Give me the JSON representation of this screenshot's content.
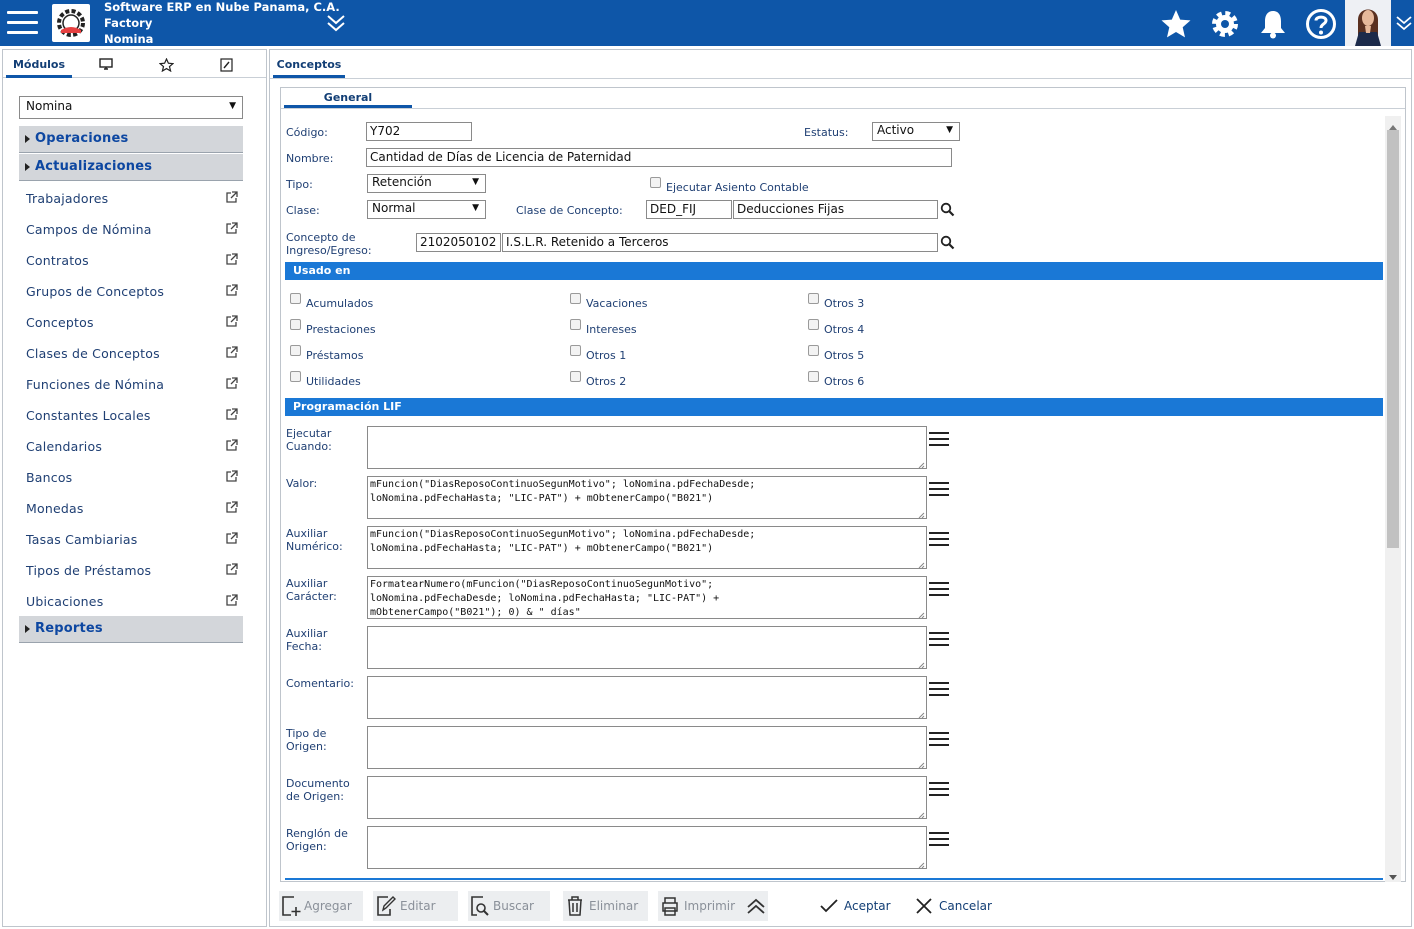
{
  "header": {
    "company_line1": "Software ERP en Nube Panama, C.A.",
    "company_line2": "Factory",
    "company_line3": "Nomina",
    "icons": [
      "menu-icon",
      "logo-icon",
      "chevron-double-down-icon",
      "star-icon",
      "gear-icon",
      "bell-icon",
      "help-icon",
      "avatar",
      "chevron-down-icon"
    ]
  },
  "sidebar": {
    "tabs": [
      {
        "label": "Módulos",
        "active": true
      },
      {
        "icon": "monitor-icon"
      },
      {
        "icon": "star-icon"
      },
      {
        "icon": "edit-icon"
      }
    ],
    "module_select": "Nomina",
    "sections": {
      "operaciones": "Operaciones",
      "actualizaciones": "Actualizaciones",
      "reportes": "Reportes"
    },
    "items": [
      "Trabajadores",
      "Campos de Nómina",
      "Contratos",
      "Grupos de Conceptos",
      "Conceptos",
      "Clases de Conceptos",
      "Funciones de Nómina",
      "Constantes Locales",
      "Calendarios",
      "Bancos",
      "Monedas",
      "Tasas Cambiarias",
      "Tipos de Préstamos",
      "Ubicaciones"
    ]
  },
  "main": {
    "tab": "Conceptos",
    "subtab": "General",
    "form": {
      "codigo_label": "Código:",
      "codigo": "Y702",
      "estatus_label": "Estatus:",
      "estatus": "Activo",
      "nombre_label": "Nombre:",
      "nombre": "Cantidad de Días de Licencia de Paternidad",
      "tipo_label": "Tipo:",
      "tipo": "Retención",
      "asiento_label": "Ejecutar Asiento Contable",
      "clase_label": "Clase:",
      "clase": "Normal",
      "clase_concepto_label": "Clase de Concepto:",
      "clase_concepto_code": "DED_FIJ",
      "clase_concepto_name": "Deducciones Fijas",
      "ingreso_label_1": "Concepto de",
      "ingreso_label_2": "Ingreso/Egreso:",
      "ingreso_code": "2102050102",
      "ingreso_name": "I.S.L.R. Retenido a Terceros"
    },
    "usado_en": {
      "title": "Usado en",
      "col1": [
        "Acumulados",
        "Prestaciones",
        "Préstamos",
        "Utilidades"
      ],
      "col2": [
        "Vacaciones",
        "Intereses",
        "Otros 1",
        "Otros 2"
      ],
      "col3": [
        "Otros 3",
        "Otros 4",
        "Otros 5",
        "Otros 6"
      ]
    },
    "programacion": {
      "title": "Programación LIF",
      "fields": [
        {
          "label1": "Ejecutar",
          "label2": "Cuando:",
          "value": ""
        },
        {
          "label1": "Valor:",
          "label2": "",
          "value": "mFuncion(\"DiasReposoContinuoSegunMotivo\"; loNomina.pdFechaDesde;\nloNomina.pdFechaHasta; \"LIC-PAT\") + mObtenerCampo(\"B021\")"
        },
        {
          "label1": "Auxiliar",
          "label2": "Numérico:",
          "value": "mFuncion(\"DiasReposoContinuoSegunMotivo\"; loNomina.pdFechaDesde;\nloNomina.pdFechaHasta; \"LIC-PAT\") + mObtenerCampo(\"B021\")"
        },
        {
          "label1": "Auxiliar",
          "label2": "Carácter:",
          "value": "FormatearNumero(mFuncion(\"DiasReposoContinuoSegunMotivo\";\nloNomina.pdFechaDesde; loNomina.pdFechaHasta; \"LIC-PAT\") +\nmObtenerCampo(\"B021\"); 0) & \" días\""
        },
        {
          "label1": "Auxiliar",
          "label2": "Fecha:",
          "value": ""
        },
        {
          "label1": "Comentario:",
          "label2": "",
          "value": ""
        },
        {
          "label1": "Tipo de",
          "label2": "Origen:",
          "value": ""
        },
        {
          "label1": "Documento",
          "label2": "de Origen:",
          "value": ""
        },
        {
          "label1": "Renglón de",
          "label2": "Origen:",
          "value": ""
        }
      ]
    }
  },
  "toolbar": {
    "agregar": "Agregar",
    "editar": "Editar",
    "buscar": "Buscar",
    "eliminar": "Eliminar",
    "imprimir": "Imprimir",
    "aceptar": "Aceptar",
    "cancelar": "Cancelar"
  }
}
